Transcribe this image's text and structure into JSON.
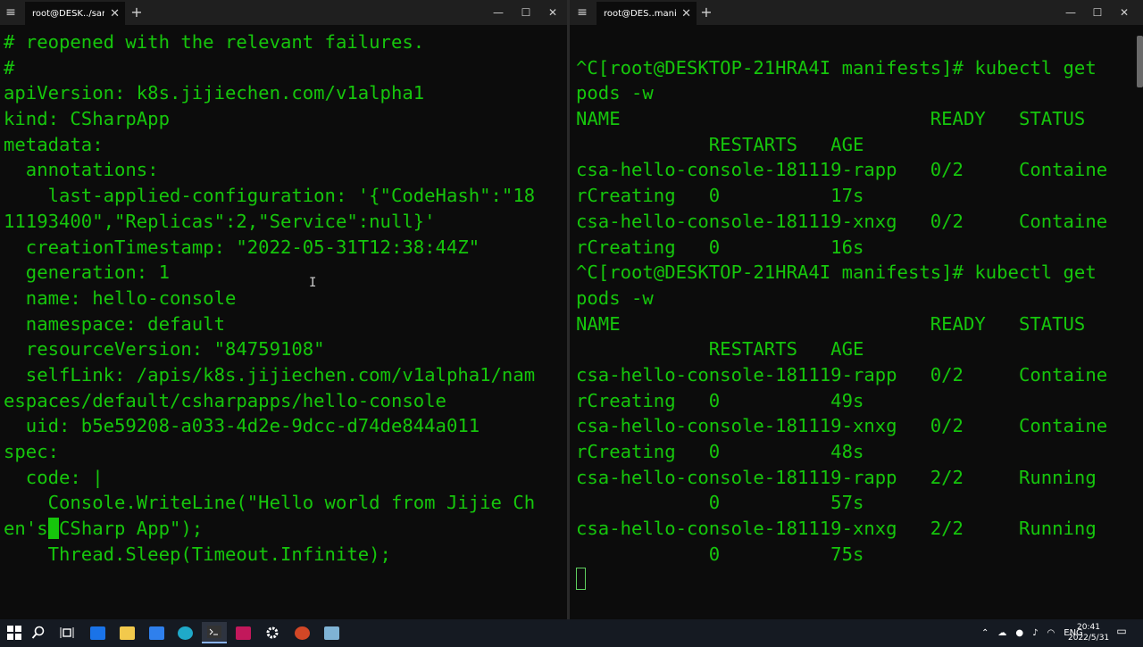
{
  "left_window": {
    "tab_title": "root@DESK../samples",
    "lines": [
      "# reopened with the relevant failures.",
      "#",
      "apiVersion: k8s.jijiechen.com/v1alpha1",
      "kind: CSharpApp",
      "metadata:",
      "  annotations:",
      "    last-applied-configuration: '{\"CodeHash\":\"18",
      "11193400\",\"Replicas\":2,\"Service\":null}'",
      "  creationTimestamp: \"2022-05-31T12:38:44Z\"",
      "  generation: 1",
      "  name: hello-console",
      "  namespace: default",
      "  resourceVersion: \"84759108\"",
      "  selfLink: /apis/k8s.jijiechen.com/v1alpha1/nam",
      "espaces/default/csharpapps/hello-console",
      "  uid: b5e59208-a033-4d2e-9dcc-d74de844a011",
      "spec:",
      "  code: |",
      "    Console.WriteLine(\"Hello world from Jijie Ch"
    ],
    "cursor_line_before": "en's",
    "cursor_char": " ",
    "cursor_line_after": "CSharp App\");",
    "last_line": "    Thread.Sleep(Timeout.Infinite);"
  },
  "right_window": {
    "tab_title": "root@DES..manifests",
    "lines": [
      "",
      "^C[root@DESKTOP-21HRA4I manifests]# kubectl get",
      "pods -w",
      "NAME                            READY   STATUS",
      "            RESTARTS   AGE",
      "csa-hello-console-181119-rapp   0/2     Containe",
      "rCreating   0          17s",
      "csa-hello-console-181119-xnxg   0/2     Containe",
      "rCreating   0          16s",
      "^C[root@DESKTOP-21HRA4I manifests]# kubectl get",
      "pods -w",
      "NAME                            READY   STATUS",
      "            RESTARTS   AGE",
      "csa-hello-console-181119-rapp   0/2     Containe",
      "rCreating   0          49s",
      "csa-hello-console-181119-xnxg   0/2     Containe",
      "rCreating   0          48s",
      "csa-hello-console-181119-rapp   2/2     Running",
      "            0          57s",
      "csa-hello-console-181119-xnxg   2/2     Running",
      "            0          75s"
    ]
  },
  "window_controls": {
    "new_tab": "+",
    "minimize": "—",
    "maximize": "☐",
    "close": "✕",
    "tab_close": "✕",
    "menu": "≡"
  },
  "taskbar": {
    "tray_lang": "ENG",
    "time": "20:41",
    "date": "2022/5/31",
    "colors": {
      "background": "#151a22",
      "terminal_text": "#16c60c"
    }
  }
}
